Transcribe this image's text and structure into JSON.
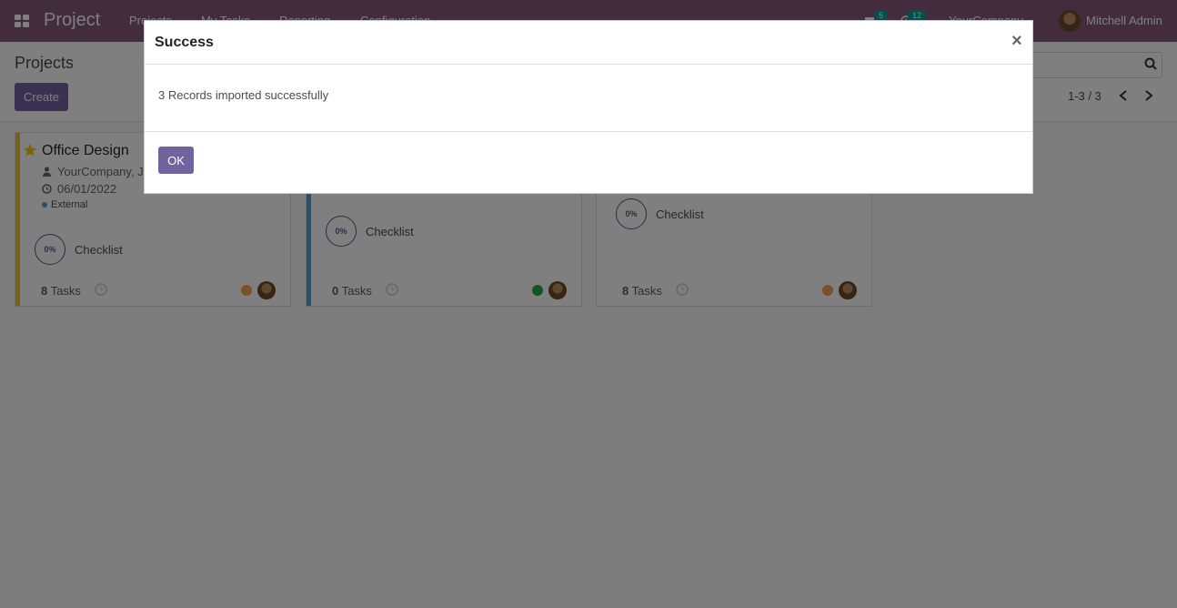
{
  "navbar": {
    "app_title": "Project",
    "menu": [
      "Projects",
      "My Tasks",
      "Reporting",
      "Configuration"
    ],
    "messages_count": "5",
    "activities_count": "12",
    "company": "YourCompany",
    "user": "Mitchell Admin"
  },
  "control_panel": {
    "title": "Projects",
    "create_label": "Create",
    "pager": "1-3 / 3"
  },
  "cards": [
    {
      "title": "Office Design",
      "customer": "YourCompany, Jo",
      "date": "06/01/2022",
      "tag": "External",
      "progress": "0%",
      "checklist_label": "Checklist",
      "tasks_count": "8",
      "tasks_label": "Tasks",
      "stripe_color": "#f0c32d",
      "status_color": "#f0a35e"
    },
    {
      "title": "",
      "progress": "0%",
      "checklist_label": "Checklist",
      "tasks_count": "0",
      "tasks_label": "Tasks",
      "stripe_color": "#4aa3df",
      "status_color": "#28a745"
    },
    {
      "title": "",
      "progress": "0%",
      "checklist_label": "Checklist",
      "tasks_count": "8",
      "tasks_label": "Tasks",
      "stripe_color": "",
      "status_color": "#f0a35e"
    }
  ],
  "modal": {
    "title": "Success",
    "close_label": "×",
    "message": "3 Records imported successfully",
    "ok_label": "OK"
  }
}
